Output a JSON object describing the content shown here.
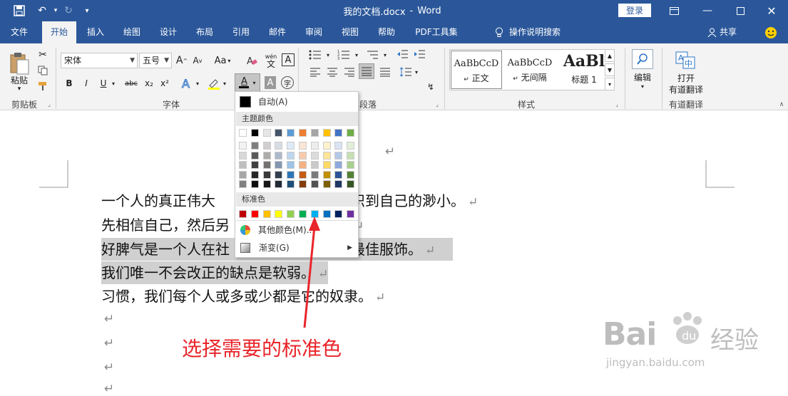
{
  "titlebar": {
    "doc_title": "我的文档.docx",
    "sep": "-",
    "app_name": "Word",
    "login_label": "登录"
  },
  "menu": {
    "tabs": [
      "文件",
      "开始",
      "插入",
      "绘图",
      "设计",
      "布局",
      "引用",
      "邮件",
      "审阅",
      "视图",
      "帮助",
      "PDF工具集"
    ],
    "tell_me": "操作说明搜索",
    "share": "共享"
  },
  "ribbon": {
    "clipboard": {
      "paste": "粘贴",
      "label": "剪贴板"
    },
    "font": {
      "name": "宋体",
      "size": "五号",
      "label": "字体",
      "bold": "B",
      "italic": "I",
      "underline": "U",
      "strike": "abc",
      "sub": "x₂",
      "sup": "x²",
      "grow": "A",
      "shrink": "A",
      "case": "Aa",
      "phonetic": "wén",
      "clear": "A",
      "char_border": "A",
      "font_color_letter": "A",
      "highlight_letter": "A",
      "enclose": "字"
    },
    "paragraph": {
      "label": "段落"
    },
    "styles": {
      "label": "样式",
      "items": [
        {
          "preview": "AaBbCcD",
          "name": "正文"
        },
        {
          "preview": "AaBbCcD",
          "name": "无间隔"
        },
        {
          "preview": "AaBl",
          "name": "标题 1"
        }
      ]
    },
    "editing": {
      "label": "编辑"
    },
    "youdao": {
      "open": "打开",
      "name": "有道翻译",
      "label": "有道翻译"
    }
  },
  "palette": {
    "auto_label": "自动(A)",
    "theme_label": "主题颜色",
    "standard_label": "标准色",
    "more_label": "其他颜色(M)...",
    "gradient_label": "渐变(G)",
    "theme_top": [
      "#ffffff",
      "#000000",
      "#e7e6e6",
      "#44546a",
      "#5b9bd5",
      "#ed7d31",
      "#a5a5a5",
      "#ffc000",
      "#4472c4",
      "#70ad47"
    ],
    "theme_shades": [
      [
        "#f2f2f2",
        "#d9d9d9",
        "#bfbfbf",
        "#a6a6a6",
        "#808080"
      ],
      [
        "#7f7f7f",
        "#595959",
        "#404040",
        "#262626",
        "#0d0d0d"
      ],
      [
        "#d0cece",
        "#aeabab",
        "#757171",
        "#3a3838",
        "#171616"
      ],
      [
        "#d6dce4",
        "#adb9ca",
        "#8497b0",
        "#333f4f",
        "#222a35"
      ],
      [
        "#deebf6",
        "#bdd7ee",
        "#9dc3e6",
        "#2e75b5",
        "#1f4e79"
      ],
      [
        "#fbe5d5",
        "#f7cbac",
        "#f4b183",
        "#c55a11",
        "#833c0b"
      ],
      [
        "#ededed",
        "#dbdbdb",
        "#c9c9c9",
        "#7b7b7b",
        "#525252"
      ],
      [
        "#fff2cc",
        "#fee599",
        "#ffd965",
        "#bf9000",
        "#7f6000"
      ],
      [
        "#dae3f3",
        "#b4c7e7",
        "#8eaadb",
        "#2f5496",
        "#1f3864"
      ],
      [
        "#e2efd9",
        "#c5e0b3",
        "#a8d08d",
        "#538135",
        "#375623"
      ]
    ],
    "standard": [
      "#c00000",
      "#ff0000",
      "#ffc000",
      "#ffff00",
      "#92d050",
      "#00b050",
      "#00b0f0",
      "#0070c0",
      "#002060",
      "#7030a0"
    ]
  },
  "document": {
    "lines": [
      {
        "a": "一个人的真正伟大",
        "b": "认识到自己的渺小。"
      },
      {
        "a": "先相信自己，然后另",
        "b": ""
      },
      {
        "a": "好脾气是一个人在社",
        "b": "最佳服饰。"
      },
      {
        "a": "我们唯一不会改正的缺点是软弱。",
        "b": ""
      },
      {
        "a": "习惯，我们每个人或多或少都是它的奴隶。",
        "b": ""
      }
    ],
    "para_mark": "↵"
  },
  "annotation": "选择需要的标准色",
  "watermark": {
    "brand": "Bai",
    "cn": "经验",
    "url": "jingyan.baidu.com"
  }
}
